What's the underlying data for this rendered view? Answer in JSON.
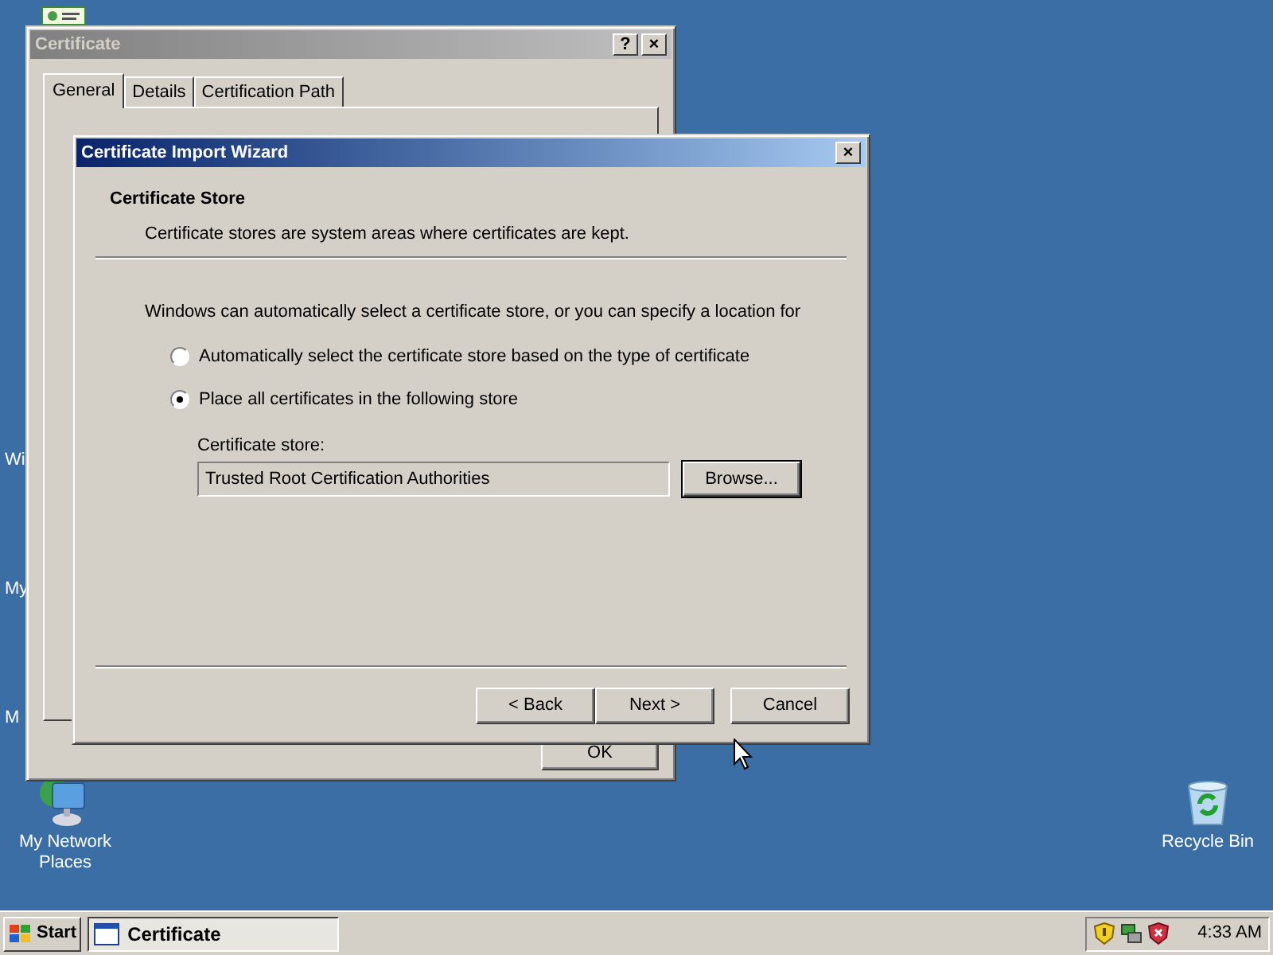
{
  "desktop": {
    "covered_labels": [
      "Wi",
      "My",
      "M"
    ],
    "icons": [
      {
        "label": "My Network Places",
        "kind": "network"
      },
      {
        "label": "Recycle Bin",
        "kind": "recycle"
      }
    ]
  },
  "certificate_window": {
    "title": "Certificate",
    "active": false,
    "title_buttons": [
      "?",
      "×"
    ],
    "tabs": [
      {
        "label": "General",
        "selected": true
      },
      {
        "label": "Details",
        "selected": false
      },
      {
        "label": "Certification Path",
        "selected": false
      }
    ],
    "ok_button": "OK"
  },
  "wizard": {
    "title": "Certificate Import Wizard",
    "active": true,
    "close": "×",
    "header": {
      "title": "Certificate Store",
      "subtitle": "Certificate stores are system areas where certificates are kept."
    },
    "intro": "Windows can automatically select a certificate store, or you can specify a location for",
    "options": [
      {
        "label": "Automatically select the certificate store based on the type of certificate",
        "selected": false
      },
      {
        "label": "Place all certificates in the following store",
        "selected": true
      }
    ],
    "store_label": "Certificate store:",
    "store_value": "Trusted Root Certification Authorities",
    "browse": "Browse...",
    "buttons": [
      "< Back",
      "Next >",
      "Cancel"
    ]
  },
  "taskbar": {
    "start": "Start",
    "tasks": [
      {
        "label": "Certificate",
        "selected": true
      }
    ],
    "clock": "4:33 AM"
  }
}
